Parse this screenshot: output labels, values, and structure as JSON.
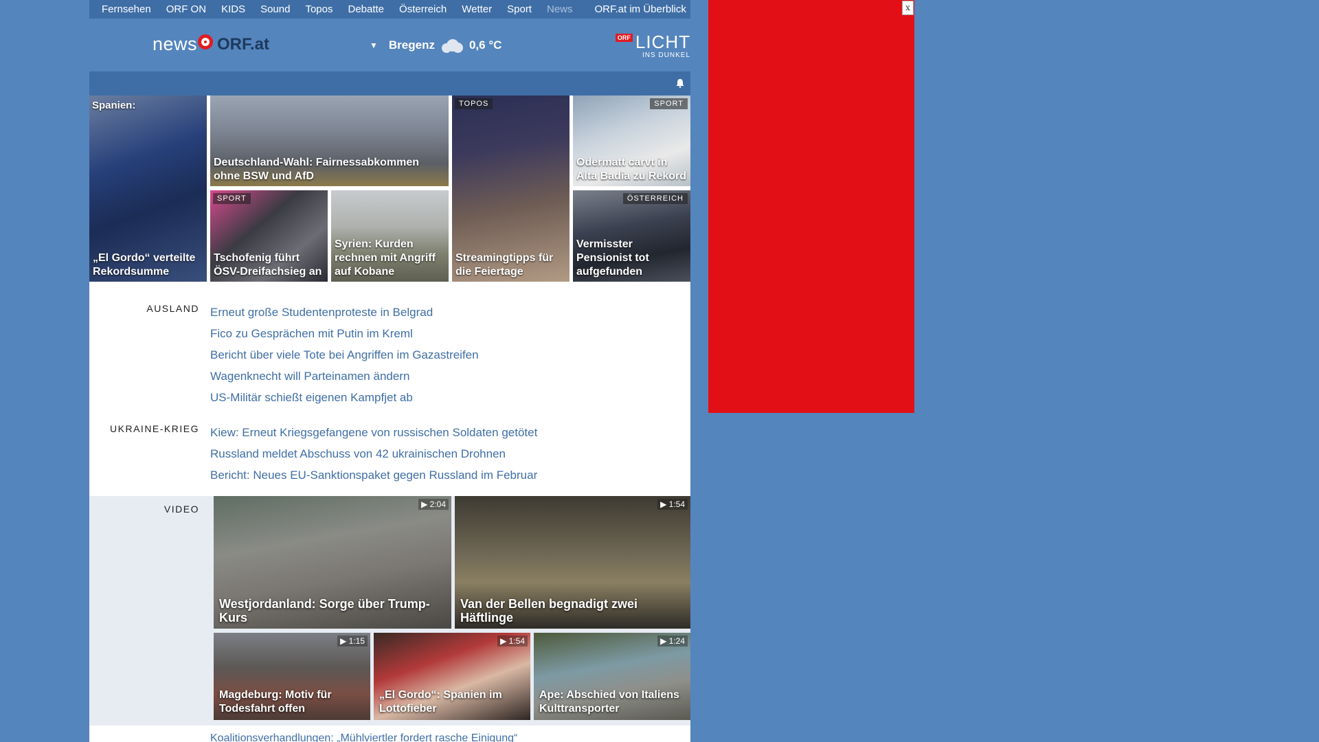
{
  "topnav": {
    "items": [
      "Fernsehen",
      "ORF ON",
      "KIDS",
      "Sound",
      "Topos",
      "Debatte",
      "Österreich",
      "Wetter",
      "Sport",
      "News"
    ],
    "overview": "ORF.at im Überblick",
    "active": "News"
  },
  "header": {
    "logo_news": "news",
    "logo_orf": "ORF.at",
    "weather_city": "Bregenz",
    "weather_temp": "0,6 °C",
    "weather_icon": "cloud-icon",
    "licht_badge": "ORF",
    "licht_big": "LICHT",
    "licht_small": "INS DUNKEL"
  },
  "teasers": [
    {
      "tag": "",
      "top_text": "Spanien:",
      "title": "„El Gordo“ verteilte Rekordsumme"
    },
    {
      "tag": "",
      "title": "Deutschland-Wahl: Fairnessabkommen ohne BSW und AfD"
    },
    {
      "tag": "TOPOS",
      "title": "Streamingtipps für die Feiertage"
    },
    {
      "tag": "SPORT",
      "title": "Odermatt carvt in Alta Badia zu Rekord"
    },
    {
      "tag": "SPORT",
      "title": "Tschofenig führt ÖSV-Dreifachsieg an"
    },
    {
      "tag": "",
      "title": "Syrien: Kurden rechnen mit Angriff auf Kobane"
    },
    {
      "tag": "ÖSTERREICH",
      "title": "Vermisster Pensionist tot aufgefunden"
    }
  ],
  "sections": [
    {
      "label": "AUSLAND",
      "links": [
        "Erneut große Studentenproteste in Belgrad",
        "Fico zu Gesprächen mit Putin im Kreml",
        "Bericht über viele Tote bei Angriffen im Gazastreifen",
        "Wagenknecht will Parteinamen ändern",
        "US-Militär schießt eigenen Kampfjet ab"
      ]
    },
    {
      "label": "UKRAINE-KRIEG",
      "links": [
        "Kiew: Erneut Kriegsgefangene von russischen Soldaten getötet",
        "Russland meldet Abschuss von 42 ukrainischen Drohnen",
        "Bericht: Neues EU-Sanktionspaket gegen Russland im Februar"
      ]
    }
  ],
  "video": {
    "label": "VIDEO",
    "tiles": [
      {
        "duration": "2:04",
        "title": "Westjordanland: Sorge über Trump-Kurs"
      },
      {
        "duration": "1:54",
        "title": "Van der Bellen begnadigt zwei Häftlinge"
      },
      {
        "duration": "1:15",
        "title": "Magdeburg: Motiv für Todesfahrt offen"
      },
      {
        "duration": "1:54",
        "title": "„El Gordo“: Spanien im Lottofieber"
      },
      {
        "duration": "1:24",
        "title": "Ape: Abschied von Italiens Kulttransporter"
      }
    ]
  },
  "bottom_link": "Koalitionsverhandlungen: „Mühlviertler fordert rasche Einigung“",
  "ad": {
    "close_label": "x",
    "color": "#e20f17"
  },
  "colors": {
    "page_bg": "#5585bd",
    "nav_bg": "#3f6ea6",
    "link": "#3f6ea6",
    "orf_red": "#e11b22"
  }
}
